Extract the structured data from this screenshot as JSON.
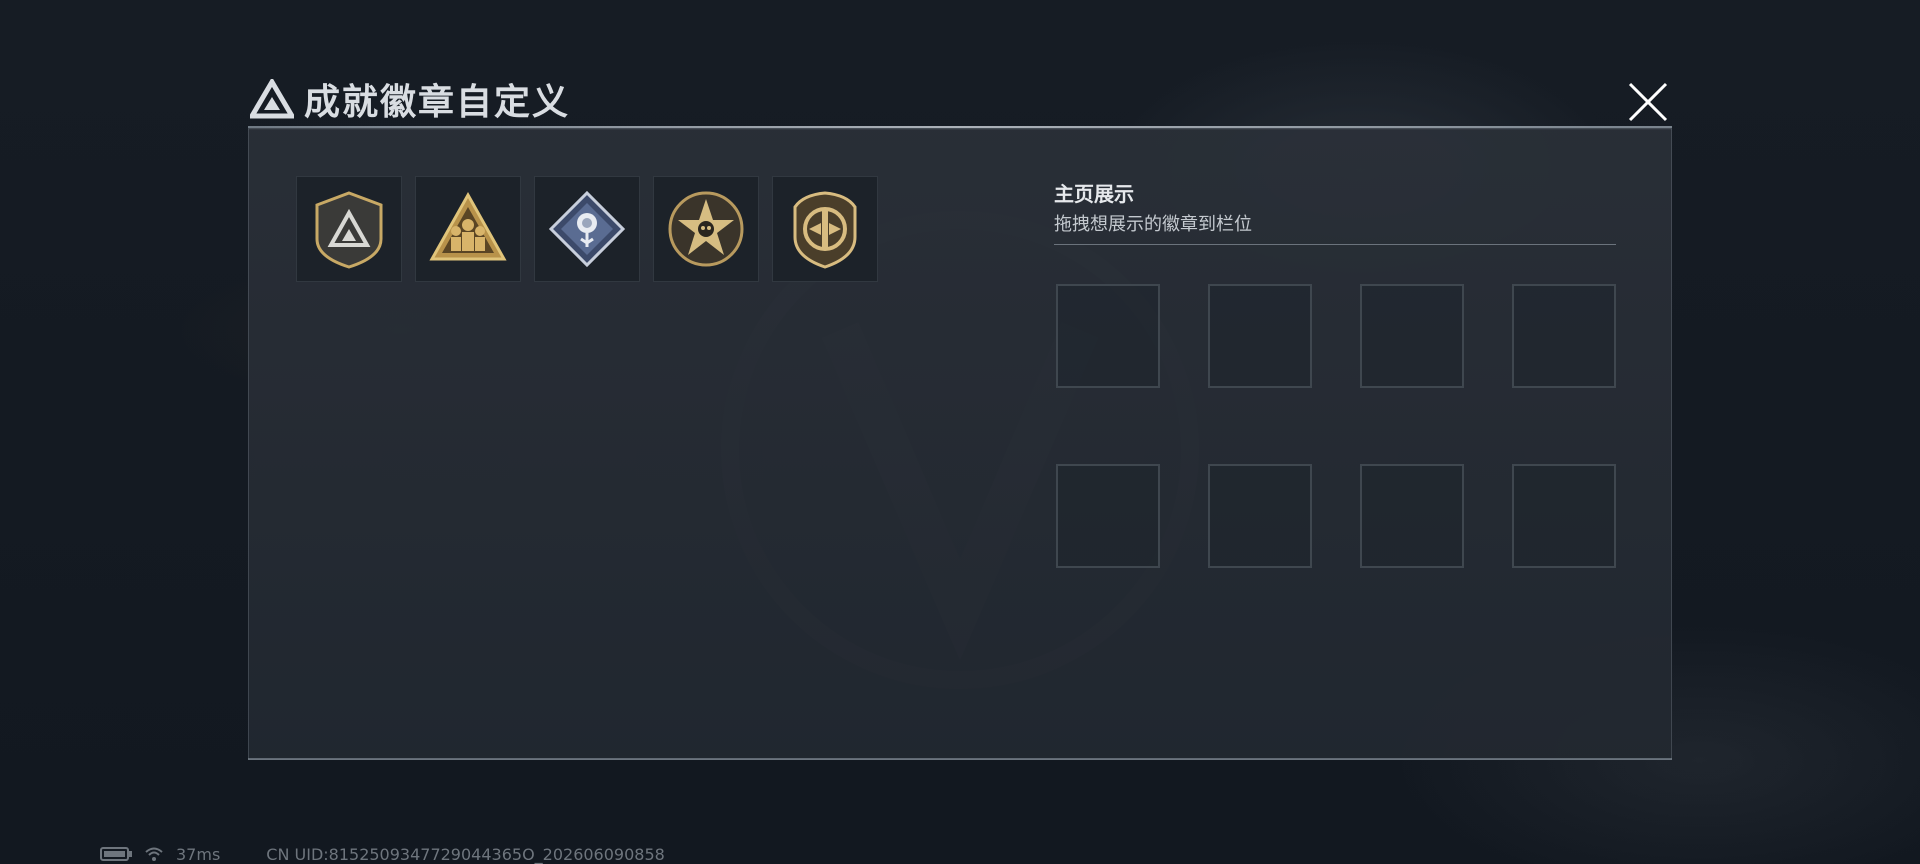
{
  "header": {
    "title": "成就徽章自定义",
    "logo_icon": "triangle-mountain-logo-icon",
    "close_icon": "close-icon"
  },
  "badges": [
    {
      "icon": "mountain-shield-badge-icon"
    },
    {
      "icon": "squad-triangle-badge-icon"
    },
    {
      "icon": "rose-diamond-badge-icon"
    },
    {
      "icon": "skull-star-badge-icon"
    },
    {
      "icon": "wing-shield-badge-icon"
    }
  ],
  "display": {
    "title": "主页展示",
    "subtitle": "拖拽想展示的徽章到栏位",
    "slots": 8
  },
  "status": {
    "ping": "37ms",
    "uid": "CN UID:8152509347729044365O_202606090858"
  },
  "colors": {
    "gold": "#c8a965",
    "panel": "#2a3038",
    "accent_line": "#c6ccd3"
  }
}
